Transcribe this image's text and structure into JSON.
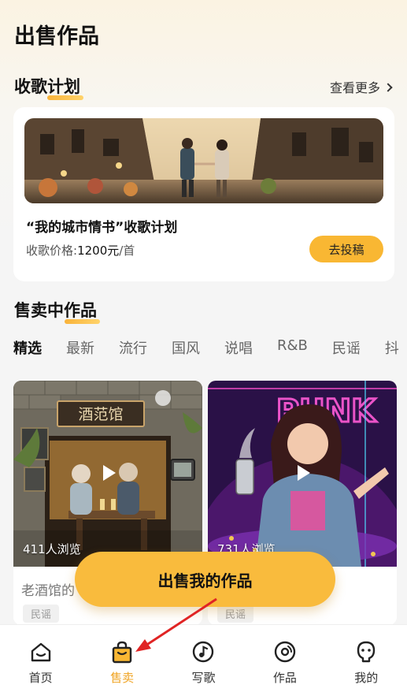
{
  "page": {
    "title": "出售作品"
  },
  "plan_section": {
    "heading": "收歌计划",
    "more_label": "查看更多",
    "card": {
      "title": "“我的城市情书”收歌计划",
      "price_label": "收歌价格:",
      "price_value": "1200元",
      "price_unit": "/首",
      "submit_label": "去投稿"
    }
  },
  "works_section": {
    "heading": "售卖中作品",
    "tabs": [
      "精选",
      "最新",
      "流行",
      "国风",
      "说唱",
      "R&B",
      "民谣",
      "抖"
    ],
    "active_tab": "精选",
    "cards": [
      {
        "views": "411人浏览",
        "name": "老酒馆的",
        "genre": "民谣",
        "sign_text": "酒范馆"
      },
      {
        "views": "731人浏览",
        "name": "",
        "genre": "民谣",
        "sign_text": "PUNK"
      }
    ]
  },
  "sell_button": {
    "label": "出售我的作品"
  },
  "tabbar": {
    "items": [
      {
        "label": "首页",
        "icon": "home-icon"
      },
      {
        "label": "售卖",
        "icon": "shopping-bag-icon",
        "active": true
      },
      {
        "label": "写歌",
        "icon": "music-note-icon"
      },
      {
        "label": "作品",
        "icon": "disc-icon"
      },
      {
        "label": "我的",
        "icon": "profile-icon"
      }
    ]
  },
  "colors": {
    "accent": "#f9b733",
    "active_tab": "#f0a526",
    "annotation_arrow": "#e02424"
  }
}
